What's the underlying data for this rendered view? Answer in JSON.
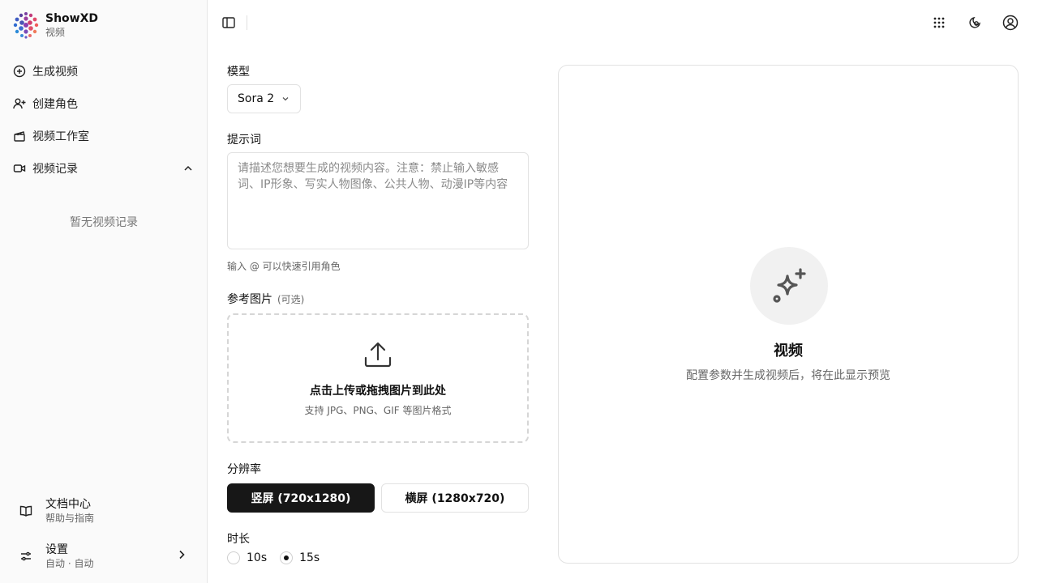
{
  "brand": {
    "name": "ShowXD",
    "subtitle": "视频"
  },
  "sidebar": {
    "items": [
      {
        "label": "生成视频",
        "icon": "plus-circle-icon"
      },
      {
        "label": "创建角色",
        "icon": "user-plus-icon"
      },
      {
        "label": "视频工作室",
        "icon": "clapperboard-icon"
      },
      {
        "label": "视频记录",
        "icon": "video-camera-icon",
        "expanded": true
      }
    ],
    "empty_records": "暂无视频记录",
    "footer": {
      "docs": {
        "title": "文档中心",
        "subtitle": "帮助与指南"
      },
      "settings": {
        "title": "设置",
        "subtitle": "自动 · 自动"
      }
    }
  },
  "form": {
    "model_label": "模型",
    "model_value": "Sora 2",
    "prompt_label": "提示词",
    "prompt_placeholder": "请描述您想要生成的视频内容。注意：禁止输入敏感词、IP形象、写实人物图像、公共人物、动漫IP等内容",
    "prompt_hint": "输入 @ 可以快速引用角色",
    "ref_label": "参考图片",
    "ref_optional": "(可选)",
    "upload_title": "点击上传或拖拽图片到此处",
    "upload_sub": "支持 JPG、PNG、GIF 等图片格式",
    "resolution_label": "分辨率",
    "resolution_options": [
      "竖屏 (720x1280)",
      "横屏 (1280x720)"
    ],
    "resolution_selected": 0,
    "duration_label": "时长",
    "duration_options": [
      "10s",
      "15s"
    ],
    "duration_selected": 1
  },
  "preview": {
    "title": "视频",
    "subtitle": "配置参数并生成视频后，将在此显示预览"
  },
  "colors": {
    "primary": "#171717",
    "sidebar_bg": "#fafafa",
    "border": "#e2e2e2",
    "muted": "#666666"
  }
}
